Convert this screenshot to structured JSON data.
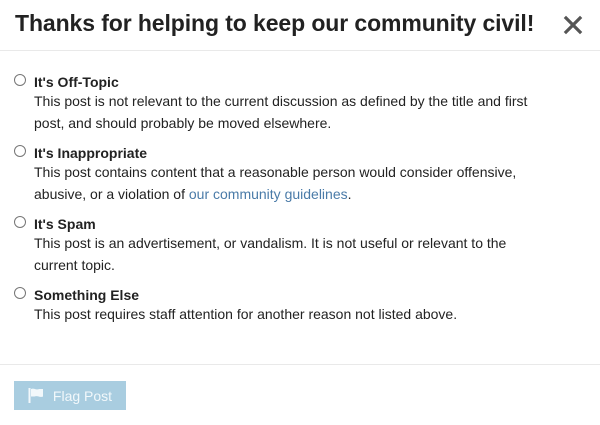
{
  "modal": {
    "title": "Thanks for helping to keep our community civil!",
    "close_icon": "close-icon"
  },
  "options": [
    {
      "id": "off_topic",
      "title": "It's Off-Topic",
      "description": "This post is not relevant to the current discussion as defined by the title and first post, and should probably be moved elsewhere."
    },
    {
      "id": "inappropriate",
      "title": "It's Inappropriate",
      "description_before": "This post contains content that a reasonable person would consider offensive, abusive, or a violation of ",
      "link_text": "our community guidelines",
      "description_after": "."
    },
    {
      "id": "spam",
      "title": "It's Spam",
      "description": "This post is an advertisement, or vandalism. It is not useful or relevant to the current topic."
    },
    {
      "id": "something_else",
      "title": "Something Else",
      "description": "This post requires staff attention for another reason not listed above."
    }
  ],
  "footer": {
    "flag_label": "Flag Post",
    "flag_icon": "flag-icon",
    "flag_disabled": true
  },
  "colors": {
    "link": "#4a7ba8",
    "button_disabled_bg": "#a9cde0",
    "divider": "#e9e9e9"
  }
}
